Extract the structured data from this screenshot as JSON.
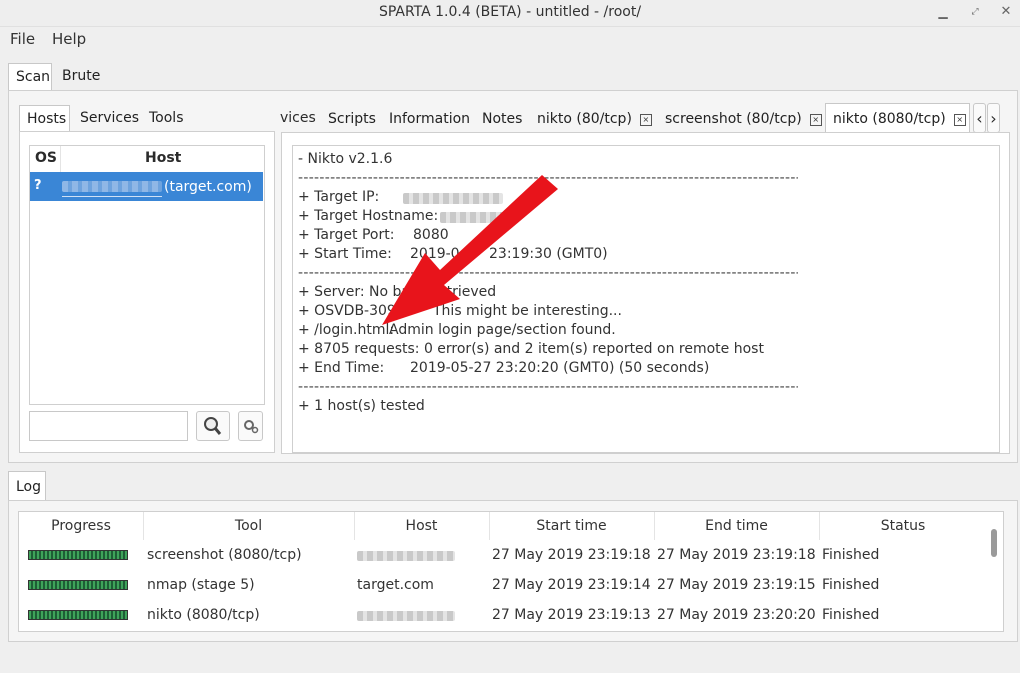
{
  "window": {
    "title": "SPARTA 1.0.4 (BETA) - untitled - /root/"
  },
  "menu": {
    "file": "File",
    "help": "Help"
  },
  "main_tabs": [
    "Scan",
    "Brute"
  ],
  "left_tabs": [
    "Hosts",
    "Services",
    "Tools"
  ],
  "hosts": {
    "col_os": "OS",
    "col_host": "Host",
    "row": {
      "os_icon": "?",
      "host": "(target.com)"
    }
  },
  "right_tabs": {
    "partial": "vices",
    "scripts": "Scripts",
    "information": "Information",
    "notes": "Notes",
    "nikto80": "nikto (80/tcp)",
    "screenshot80": "screenshot (80/tcp)",
    "nikto8080": "nikto (8080/tcp)",
    "nav_left": "‹",
    "nav_right": "›",
    "close_glyph": "×"
  },
  "nikto_output": {
    "line1": "- Nikto v2.1.6",
    "dash": "--------------------------------------------------------------------------------------------------",
    "target_ip": "+ Target IP:",
    "target_hostname": "+ Target Hostname:",
    "target_port": "+ Target Port:",
    "target_port_value": "8080",
    "start_time": "+ Start Time:",
    "start_time_a": "2019-0",
    "start_time_b": "23:19:30 (GMT0)",
    "server_a": "+ Server: No ba",
    "server_b": "etrieved",
    "osvdb_a": "+ OSVDB-309",
    "osvdb_b": "This might be interesting...",
    "login_a": "+ /login.html:",
    "login_b": "Admin login page/section found.",
    "requests": "+ 8705 requests: 0 error(s) and 2 item(s) reported on remote host",
    "end_time": "+ End Time:",
    "end_time_value": "2019-05-27 23:20:20 (GMT0) (50 seconds)",
    "hosts_tested": "+ 1 host(s) tested"
  },
  "annotation": {
    "arrow_color": "#e8141b"
  },
  "log": {
    "tab": "Log",
    "headers": [
      "Progress",
      "Tool",
      "Host",
      "Start time",
      "End time",
      "Status"
    ],
    "rows": [
      {
        "progress": 1.0,
        "tool": "screenshot (8080/tcp)",
        "host": "",
        "start": "27 May 2019 23:19:18",
        "end": "27 May 2019 23:19:18",
        "status": "Finished"
      },
      {
        "progress": 1.0,
        "tool": "nmap (stage 5)",
        "host": "target.com",
        "start": "27 May 2019 23:19:14",
        "end": "27 May 2019 23:19:15",
        "status": "Finished"
      },
      {
        "progress": 1.0,
        "tool": "nikto (8080/tcp)",
        "host": "",
        "start": "27 May 2019 23:19:13",
        "end": "27 May 2019 23:20:20",
        "status": "Finished"
      }
    ]
  },
  "colors": {
    "selection": "#3a86d6",
    "progress": "#3fa35a"
  }
}
